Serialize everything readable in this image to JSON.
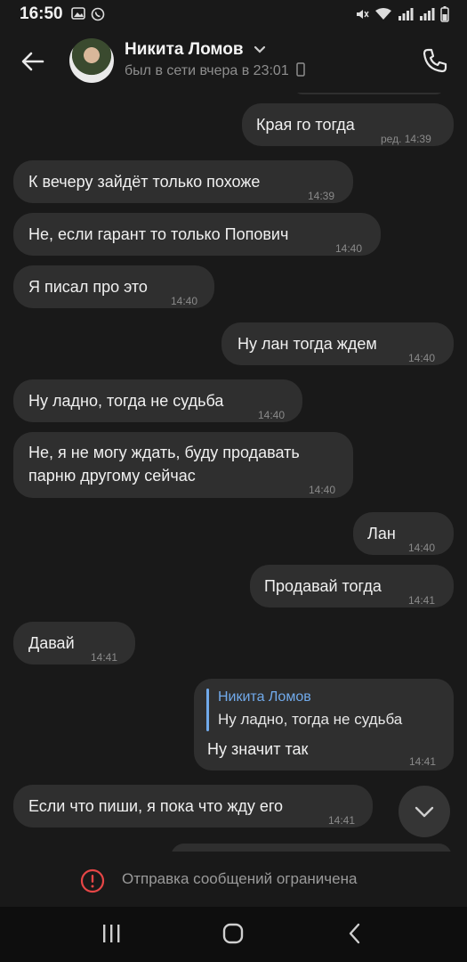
{
  "status_bar": {
    "time": "16:50"
  },
  "header": {
    "contact_name": "Никита Ломов",
    "last_seen": "был в сети вчера в 23:01"
  },
  "messages": [
    {
      "dir": "out",
      "text": "Края го тогда",
      "time": "ред. 14:39"
    },
    {
      "dir": "in",
      "text": "К вечеру зайдёт только похоже",
      "time": "14:39"
    },
    {
      "dir": "in",
      "text": "Не, если гарант то только Попович",
      "time": "14:40"
    },
    {
      "dir": "in",
      "text": "Я писал про это",
      "time": "14:40"
    },
    {
      "dir": "out",
      "text": "Ну лан тогда ждем",
      "time": "14:40"
    },
    {
      "dir": "in",
      "text": "Ну ладно, тогда не судьба",
      "time": "14:40"
    },
    {
      "dir": "in",
      "line1": "Не, я не могу ждать, буду продавать",
      "line2": "парню другому сейчас",
      "time": "14:40"
    },
    {
      "dir": "out",
      "text": "Лан",
      "time": "14:40"
    },
    {
      "dir": "out",
      "text": "Продавай тогда",
      "time": "14:41"
    },
    {
      "dir": "in",
      "text": "Давай",
      "time": "14:41"
    },
    {
      "dir": "out",
      "reply_name": "Никита Ломов",
      "reply_text": "Ну ладно, тогда не судьба",
      "text": "Ну значит так",
      "time": "14:41"
    },
    {
      "dir": "in",
      "text": "Если что пиши, я пока что жду его",
      "time": "14:41"
    }
  ],
  "footer": {
    "restriction_text": "Отправка сообщений ограничена"
  }
}
